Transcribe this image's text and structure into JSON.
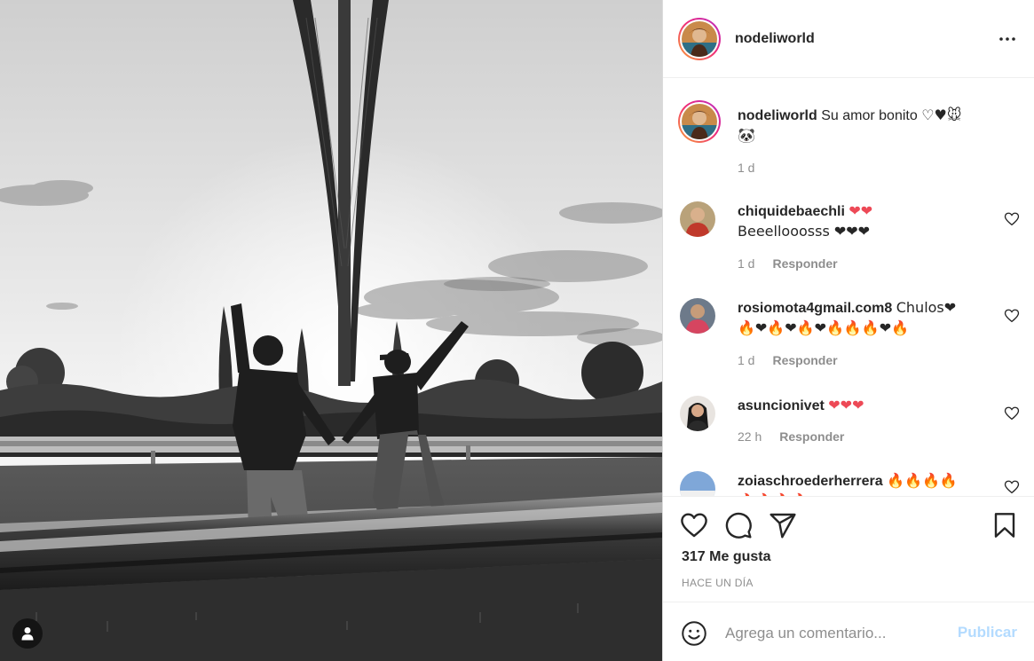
{
  "post": {
    "image_alt": "Black and white photo of a couple pointing up near a bridge",
    "username": "nodeliworld",
    "caption": {
      "username": "nodeliworld",
      "text": "Su amor bonito",
      "emojis_line1": "♡♥🐭",
      "emojis_line2": "🐼",
      "time": "1 d"
    },
    "comments": [
      {
        "username": "chiquidebaechli",
        "text_inline": "❤❤",
        "text_line2": "Beeellooosss ❤❤❤",
        "time": "1 d",
        "reply_label": "Responder"
      },
      {
        "username": "rosiomota4gmail.com8",
        "text_inline": "Chulos❤",
        "text_line2": "🔥❤🔥❤🔥❤🔥🔥🔥❤🔥",
        "time": "1 d",
        "reply_label": "Responder"
      },
      {
        "username": "asuncionivet",
        "text_inline": "❤❤❤",
        "text_line2": "",
        "time": "22 h",
        "reply_label": "Responder"
      },
      {
        "username": "zoiaschroederherrera",
        "text_inline": "🔥🔥🔥🔥",
        "text_line2": "🔥🔥🔥🔥",
        "time": "",
        "reply_label": ""
      }
    ],
    "likes": "317 Me gusta",
    "posted_ago": "HACE UN DÍA"
  },
  "add_comment": {
    "placeholder": "Agrega un comentario...",
    "publish_label": "Publicar"
  },
  "icons": {
    "more": "more-horizontal-icon",
    "like": "heart-icon",
    "comment": "comment-bubble-icon",
    "share": "paper-plane-icon",
    "save": "bookmark-icon",
    "emoji": "smiley-icon",
    "user_tag": "user-silhouette-icon"
  },
  "colors": {
    "text": "#262626",
    "muted": "#8e8e8e",
    "border": "#dbdbdb",
    "publish_disabled": "#b3dbff",
    "heart_red": "#ed4956"
  }
}
